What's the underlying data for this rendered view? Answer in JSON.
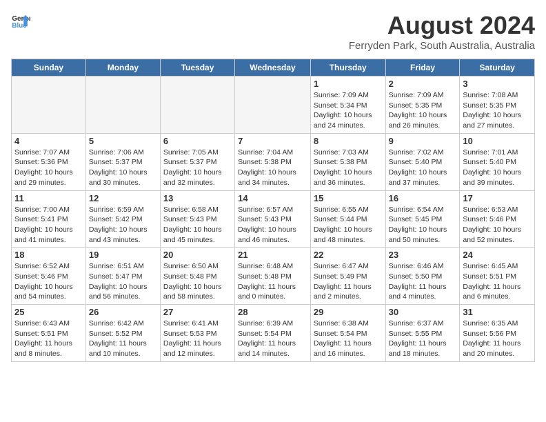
{
  "header": {
    "logo_line1": "General",
    "logo_line2": "Blue",
    "title": "August 2024",
    "subtitle": "Ferryden Park, South Australia, Australia"
  },
  "days_of_week": [
    "Sunday",
    "Monday",
    "Tuesday",
    "Wednesday",
    "Thursday",
    "Friday",
    "Saturday"
  ],
  "weeks": [
    [
      {
        "num": "",
        "info": ""
      },
      {
        "num": "",
        "info": ""
      },
      {
        "num": "",
        "info": ""
      },
      {
        "num": "",
        "info": ""
      },
      {
        "num": "1",
        "info": "Sunrise: 7:09 AM\nSunset: 5:34 PM\nDaylight: 10 hours\nand 24 minutes."
      },
      {
        "num": "2",
        "info": "Sunrise: 7:09 AM\nSunset: 5:35 PM\nDaylight: 10 hours\nand 26 minutes."
      },
      {
        "num": "3",
        "info": "Sunrise: 7:08 AM\nSunset: 5:35 PM\nDaylight: 10 hours\nand 27 minutes."
      }
    ],
    [
      {
        "num": "4",
        "info": "Sunrise: 7:07 AM\nSunset: 5:36 PM\nDaylight: 10 hours\nand 29 minutes."
      },
      {
        "num": "5",
        "info": "Sunrise: 7:06 AM\nSunset: 5:37 PM\nDaylight: 10 hours\nand 30 minutes."
      },
      {
        "num": "6",
        "info": "Sunrise: 7:05 AM\nSunset: 5:37 PM\nDaylight: 10 hours\nand 32 minutes."
      },
      {
        "num": "7",
        "info": "Sunrise: 7:04 AM\nSunset: 5:38 PM\nDaylight: 10 hours\nand 34 minutes."
      },
      {
        "num": "8",
        "info": "Sunrise: 7:03 AM\nSunset: 5:38 PM\nDaylight: 10 hours\nand 36 minutes."
      },
      {
        "num": "9",
        "info": "Sunrise: 7:02 AM\nSunset: 5:40 PM\nDaylight: 10 hours\nand 37 minutes."
      },
      {
        "num": "10",
        "info": "Sunrise: 7:01 AM\nSunset: 5:40 PM\nDaylight: 10 hours\nand 39 minutes."
      }
    ],
    [
      {
        "num": "11",
        "info": "Sunrise: 7:00 AM\nSunset: 5:41 PM\nDaylight: 10 hours\nand 41 minutes."
      },
      {
        "num": "12",
        "info": "Sunrise: 6:59 AM\nSunset: 5:42 PM\nDaylight: 10 hours\nand 43 minutes."
      },
      {
        "num": "13",
        "info": "Sunrise: 6:58 AM\nSunset: 5:43 PM\nDaylight: 10 hours\nand 45 minutes."
      },
      {
        "num": "14",
        "info": "Sunrise: 6:57 AM\nSunset: 5:43 PM\nDaylight: 10 hours\nand 46 minutes."
      },
      {
        "num": "15",
        "info": "Sunrise: 6:55 AM\nSunset: 5:44 PM\nDaylight: 10 hours\nand 48 minutes."
      },
      {
        "num": "16",
        "info": "Sunrise: 6:54 AM\nSunset: 5:45 PM\nDaylight: 10 hours\nand 50 minutes."
      },
      {
        "num": "17",
        "info": "Sunrise: 6:53 AM\nSunset: 5:46 PM\nDaylight: 10 hours\nand 52 minutes."
      }
    ],
    [
      {
        "num": "18",
        "info": "Sunrise: 6:52 AM\nSunset: 5:46 PM\nDaylight: 10 hours\nand 54 minutes."
      },
      {
        "num": "19",
        "info": "Sunrise: 6:51 AM\nSunset: 5:47 PM\nDaylight: 10 hours\nand 56 minutes."
      },
      {
        "num": "20",
        "info": "Sunrise: 6:50 AM\nSunset: 5:48 PM\nDaylight: 10 hours\nand 58 minutes."
      },
      {
        "num": "21",
        "info": "Sunrise: 6:48 AM\nSunset: 5:48 PM\nDaylight: 11 hours\nand 0 minutes."
      },
      {
        "num": "22",
        "info": "Sunrise: 6:47 AM\nSunset: 5:49 PM\nDaylight: 11 hours\nand 2 minutes."
      },
      {
        "num": "23",
        "info": "Sunrise: 6:46 AM\nSunset: 5:50 PM\nDaylight: 11 hours\nand 4 minutes."
      },
      {
        "num": "24",
        "info": "Sunrise: 6:45 AM\nSunset: 5:51 PM\nDaylight: 11 hours\nand 6 minutes."
      }
    ],
    [
      {
        "num": "25",
        "info": "Sunrise: 6:43 AM\nSunset: 5:51 PM\nDaylight: 11 hours\nand 8 minutes."
      },
      {
        "num": "26",
        "info": "Sunrise: 6:42 AM\nSunset: 5:52 PM\nDaylight: 11 hours\nand 10 minutes."
      },
      {
        "num": "27",
        "info": "Sunrise: 6:41 AM\nSunset: 5:53 PM\nDaylight: 11 hours\nand 12 minutes."
      },
      {
        "num": "28",
        "info": "Sunrise: 6:39 AM\nSunset: 5:54 PM\nDaylight: 11 hours\nand 14 minutes."
      },
      {
        "num": "29",
        "info": "Sunrise: 6:38 AM\nSunset: 5:54 PM\nDaylight: 11 hours\nand 16 minutes."
      },
      {
        "num": "30",
        "info": "Sunrise: 6:37 AM\nSunset: 5:55 PM\nDaylight: 11 hours\nand 18 minutes."
      },
      {
        "num": "31",
        "info": "Sunrise: 6:35 AM\nSunset: 5:56 PM\nDaylight: 11 hours\nand 20 minutes."
      }
    ]
  ]
}
